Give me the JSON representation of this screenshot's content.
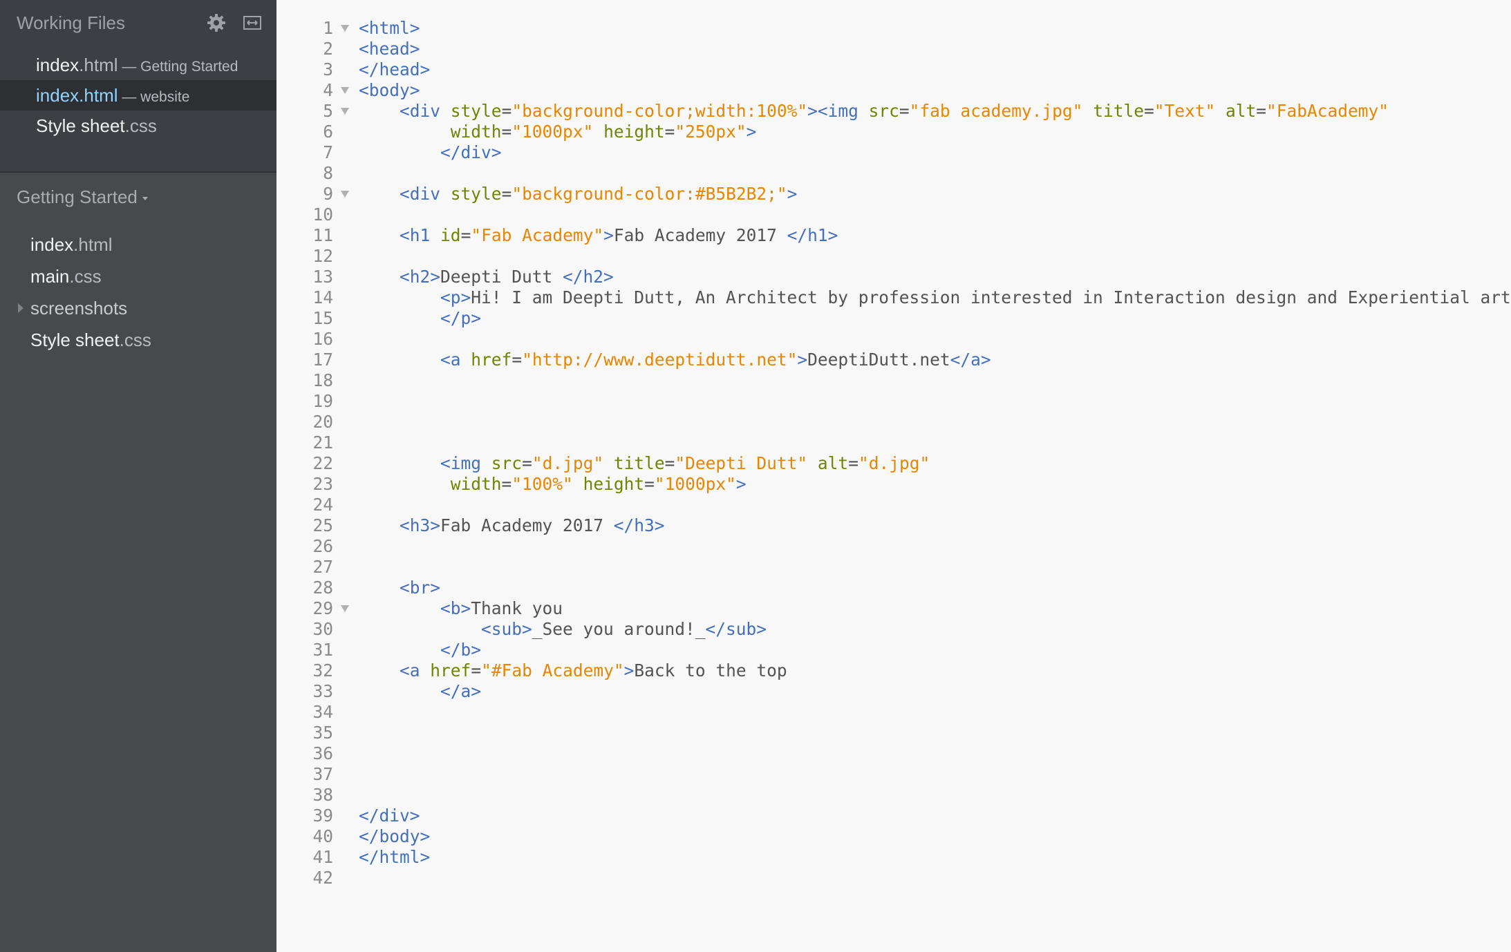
{
  "sidebar": {
    "working_files_title": "Working Files",
    "header_icons": [
      "gear-icon",
      "expand-icon"
    ],
    "working_files": [
      {
        "name": "index",
        "ext": ".html",
        "project": " — Getting Started",
        "active": false
      },
      {
        "name": "index",
        "ext": ".html",
        "project": " — website",
        "active": true
      },
      {
        "name": "Style sheet",
        "ext": ".css",
        "project": "",
        "active": false
      }
    ],
    "project_title": "Getting Started",
    "tree": [
      {
        "name": "index",
        "ext": ".html",
        "folder": false
      },
      {
        "name": "main",
        "ext": ".css",
        "folder": false
      },
      {
        "name": "screenshots",
        "ext": "",
        "folder": true
      },
      {
        "name": "Style sheet",
        "ext": ".css",
        "folder": false
      }
    ]
  },
  "editor": {
    "lines": [
      {
        "n": "1",
        "fold": true,
        "tokens": [
          [
            "t",
            "<html>"
          ]
        ]
      },
      {
        "n": "2",
        "fold": false,
        "tokens": [
          [
            "t",
            "<head>"
          ]
        ]
      },
      {
        "n": "3",
        "fold": false,
        "tokens": [
          [
            "t",
            "</head>"
          ]
        ]
      },
      {
        "n": "4",
        "fold": true,
        "tokens": [
          [
            "t",
            "<body>"
          ]
        ]
      },
      {
        "n": "5",
        "fold": true,
        "tokens": [
          [
            "x",
            "    "
          ],
          [
            "t",
            "<div"
          ],
          [
            "x",
            " "
          ],
          [
            "a",
            "style"
          ],
          [
            "x",
            "="
          ],
          [
            "v",
            "\"background-color;width:100%\""
          ],
          [
            "t",
            ">"
          ],
          [
            "t",
            "<img"
          ],
          [
            "x",
            " "
          ],
          [
            "a",
            "src"
          ],
          [
            "x",
            "="
          ],
          [
            "v",
            "\"fab academy.jpg\""
          ],
          [
            "x",
            " "
          ],
          [
            "a",
            "title"
          ],
          [
            "x",
            "="
          ],
          [
            "v",
            "\"Text\""
          ],
          [
            "x",
            " "
          ],
          [
            "a",
            "alt"
          ],
          [
            "x",
            "="
          ],
          [
            "v",
            "\"FabAcademy\""
          ]
        ]
      },
      {
        "n": "6",
        "fold": false,
        "tokens": [
          [
            "x",
            "         "
          ],
          [
            "a",
            "width"
          ],
          [
            "x",
            "="
          ],
          [
            "v",
            "\"1000px\""
          ],
          [
            "x",
            " "
          ],
          [
            "a",
            "height"
          ],
          [
            "x",
            "="
          ],
          [
            "v",
            "\"250px\""
          ],
          [
            "t",
            ">"
          ]
        ]
      },
      {
        "n": "7",
        "fold": false,
        "tokens": [
          [
            "x",
            "        "
          ],
          [
            "t",
            "</div>"
          ]
        ]
      },
      {
        "n": "8",
        "fold": false,
        "tokens": []
      },
      {
        "n": "9",
        "fold": true,
        "tokens": [
          [
            "x",
            "    "
          ],
          [
            "t",
            "<div"
          ],
          [
            "x",
            " "
          ],
          [
            "a",
            "style"
          ],
          [
            "x",
            "="
          ],
          [
            "v",
            "\"background-color:#B5B2B2;\""
          ],
          [
            "t",
            ">"
          ]
        ]
      },
      {
        "n": "10",
        "fold": false,
        "tokens": []
      },
      {
        "n": "11",
        "fold": false,
        "tokens": [
          [
            "x",
            "    "
          ],
          [
            "t",
            "<h1"
          ],
          [
            "x",
            " "
          ],
          [
            "a",
            "id"
          ],
          [
            "x",
            "="
          ],
          [
            "v",
            "\"Fab Academy\""
          ],
          [
            "t",
            ">"
          ],
          [
            "x",
            "Fab Academy 2017 "
          ],
          [
            "t",
            "</h1>"
          ]
        ]
      },
      {
        "n": "12",
        "fold": false,
        "tokens": []
      },
      {
        "n": "13",
        "fold": false,
        "tokens": [
          [
            "x",
            "    "
          ],
          [
            "t",
            "<h2>"
          ],
          [
            "x",
            "Deepti Dutt "
          ],
          [
            "t",
            "</h2>"
          ]
        ]
      },
      {
        "n": "14",
        "fold": false,
        "tokens": [
          [
            "x",
            "        "
          ],
          [
            "t",
            "<p>"
          ],
          [
            "x",
            "Hi! I am Deepti Dutt, An Architect by profession interested in Interaction design and Experiential art"
          ]
        ]
      },
      {
        "n": "15",
        "fold": false,
        "tokens": [
          [
            "x",
            "        "
          ],
          [
            "t",
            "</p>"
          ]
        ]
      },
      {
        "n": "16",
        "fold": false,
        "tokens": []
      },
      {
        "n": "17",
        "fold": false,
        "tokens": [
          [
            "x",
            "        "
          ],
          [
            "t",
            "<a"
          ],
          [
            "x",
            " "
          ],
          [
            "a",
            "href"
          ],
          [
            "x",
            "="
          ],
          [
            "v",
            "\"http://www.deeptidutt.net\""
          ],
          [
            "t",
            ">"
          ],
          [
            "x",
            "DeeptiDutt.net"
          ],
          [
            "t",
            "</a>"
          ]
        ]
      },
      {
        "n": "18",
        "fold": false,
        "tokens": []
      },
      {
        "n": "19",
        "fold": false,
        "tokens": []
      },
      {
        "n": "20",
        "fold": false,
        "tokens": []
      },
      {
        "n": "21",
        "fold": false,
        "tokens": []
      },
      {
        "n": "22",
        "fold": false,
        "tokens": [
          [
            "x",
            "        "
          ],
          [
            "t",
            "<img"
          ],
          [
            "x",
            " "
          ],
          [
            "a",
            "src"
          ],
          [
            "x",
            "="
          ],
          [
            "v",
            "\"d.jpg\""
          ],
          [
            "x",
            " "
          ],
          [
            "a",
            "title"
          ],
          [
            "x",
            "="
          ],
          [
            "v",
            "\"Deepti Dutt\""
          ],
          [
            "x",
            " "
          ],
          [
            "a",
            "alt"
          ],
          [
            "x",
            "="
          ],
          [
            "v",
            "\"d.jpg\""
          ]
        ]
      },
      {
        "n": "23",
        "fold": false,
        "tokens": [
          [
            "x",
            "         "
          ],
          [
            "a",
            "width"
          ],
          [
            "x",
            "="
          ],
          [
            "v",
            "\"100%\""
          ],
          [
            "x",
            " "
          ],
          [
            "a",
            "height"
          ],
          [
            "x",
            "="
          ],
          [
            "v",
            "\"1000px\""
          ],
          [
            "t",
            ">"
          ]
        ]
      },
      {
        "n": "24",
        "fold": false,
        "tokens": []
      },
      {
        "n": "25",
        "fold": false,
        "tokens": [
          [
            "x",
            "    "
          ],
          [
            "t",
            "<h3>"
          ],
          [
            "x",
            "Fab Academy 2017 "
          ],
          [
            "t",
            "</h3>"
          ]
        ]
      },
      {
        "n": "26",
        "fold": false,
        "tokens": []
      },
      {
        "n": "27",
        "fold": false,
        "tokens": []
      },
      {
        "n": "28",
        "fold": false,
        "tokens": [
          [
            "x",
            "    "
          ],
          [
            "t",
            "<br>"
          ]
        ]
      },
      {
        "n": "29",
        "fold": true,
        "tokens": [
          [
            "x",
            "        "
          ],
          [
            "t",
            "<b>"
          ],
          [
            "x",
            "Thank you"
          ]
        ]
      },
      {
        "n": "30",
        "fold": false,
        "tokens": [
          [
            "x",
            "            "
          ],
          [
            "t",
            "<sub>"
          ],
          [
            "x",
            "_See you around!_"
          ],
          [
            "t",
            "</sub>"
          ]
        ]
      },
      {
        "n": "31",
        "fold": false,
        "tokens": [
          [
            "x",
            "        "
          ],
          [
            "t",
            "</b>"
          ]
        ]
      },
      {
        "n": "32",
        "fold": false,
        "tokens": [
          [
            "x",
            "    "
          ],
          [
            "t",
            "<a"
          ],
          [
            "x",
            " "
          ],
          [
            "a",
            "href"
          ],
          [
            "x",
            "="
          ],
          [
            "v",
            "\"#Fab Academy\""
          ],
          [
            "t",
            ">"
          ],
          [
            "x",
            "Back to the top"
          ]
        ]
      },
      {
        "n": "33",
        "fold": false,
        "tokens": [
          [
            "x",
            "        "
          ],
          [
            "t",
            "</a>"
          ]
        ]
      },
      {
        "n": "34",
        "fold": false,
        "tokens": []
      },
      {
        "n": "35",
        "fold": false,
        "tokens": []
      },
      {
        "n": "36",
        "fold": false,
        "tokens": []
      },
      {
        "n": "37",
        "fold": false,
        "tokens": []
      },
      {
        "n": "38",
        "fold": false,
        "tokens": []
      },
      {
        "n": "39",
        "fold": false,
        "tokens": [
          [
            "t",
            "</div>"
          ]
        ]
      },
      {
        "n": "40",
        "fold": false,
        "tokens": [
          [
            "t",
            "</body>"
          ]
        ]
      },
      {
        "n": "41",
        "fold": false,
        "tokens": [
          [
            "t",
            "</html>"
          ]
        ]
      },
      {
        "n": "42",
        "fold": false,
        "tokens": []
      }
    ]
  }
}
